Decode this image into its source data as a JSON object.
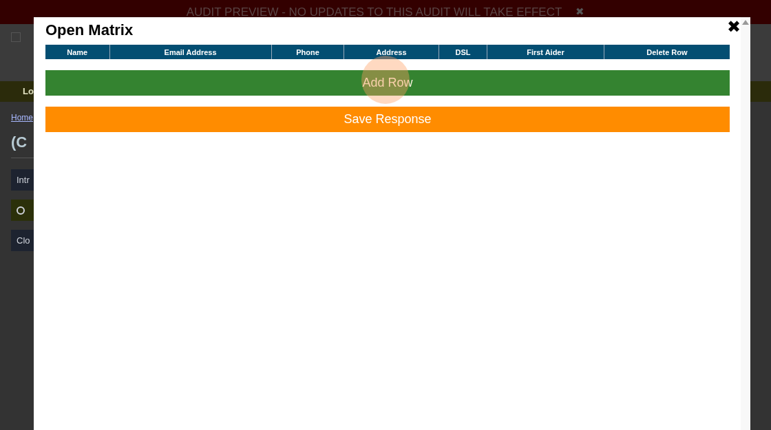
{
  "banner": {
    "text": "AUDIT PREVIEW - NO UPDATES TO THIS AUDIT WILL TAKE EFFECT",
    "close": "✖"
  },
  "background_page": {
    "nav_item": "Lo",
    "breadcrumb": "Home",
    "heading": "(C",
    "sections": [
      {
        "kind": "plain",
        "label": "Intr"
      },
      {
        "kind": "status"
      },
      {
        "kind": "plain",
        "label": "Clo"
      }
    ]
  },
  "modal": {
    "title": "Open Matrix",
    "close": "✖",
    "table": {
      "columns": [
        "Name",
        "Email Address",
        "Phone",
        "Address",
        "DSL",
        "First Aider",
        "Delete Row"
      ]
    },
    "buttons": [
      {
        "kind": "add",
        "label": "Add Row"
      },
      {
        "kind": "save",
        "label": "Save Response"
      }
    ]
  }
}
